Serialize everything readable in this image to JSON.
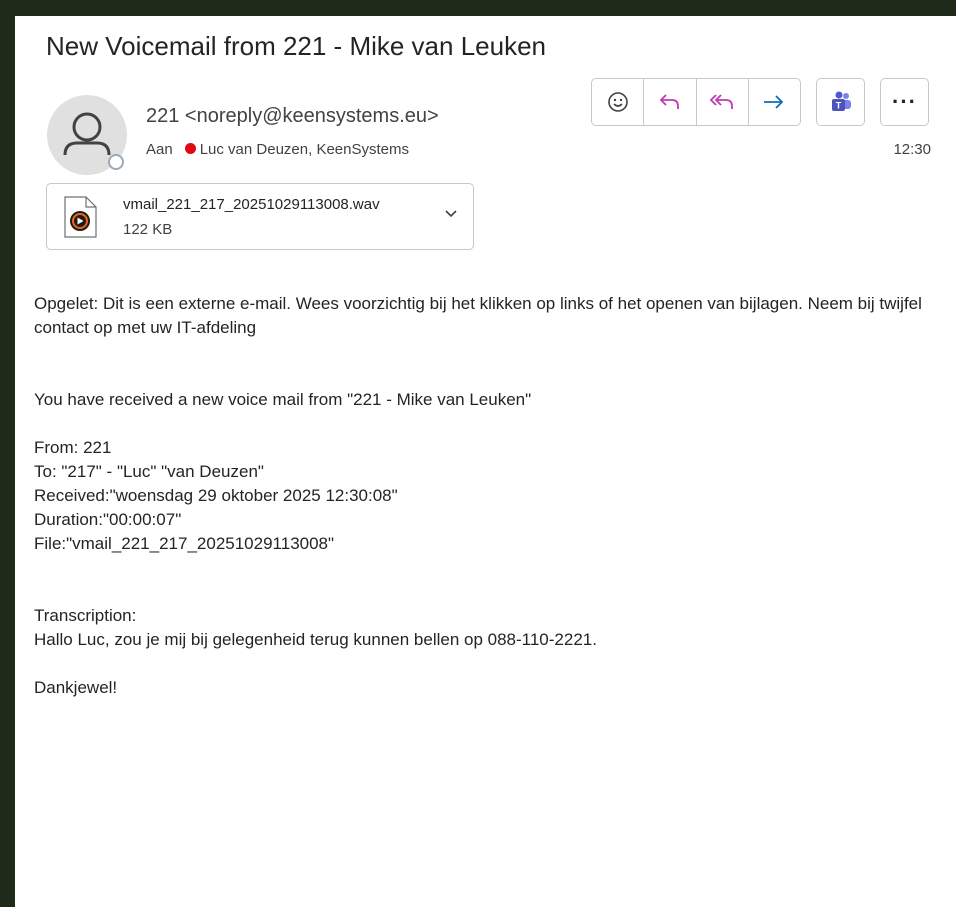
{
  "email": {
    "subject": "New Voicemail from 221 - Mike van Leuken",
    "sender": "221 <noreply@keensystems.eu>",
    "to_label": "Aan",
    "recipients": "Luc van Deuzen, KeenSystems",
    "time": "12:30"
  },
  "attachment": {
    "filename": "vmail_221_217_20251029113008.wav",
    "size": "122 KB"
  },
  "toolbar": {
    "icons": [
      "emoji-icon",
      "reply-icon",
      "reply-all-icon",
      "forward-icon",
      "teams-icon",
      "more-icon"
    ]
  },
  "body": {
    "warning": "Opgelet: Dit is een externe e-mail. Wees voorzichtig bij het klikken op links of het openen van bijlagen. Neem bij twijfel contact op met uw IT-afdeling",
    "intro": "You have received a new voice mail from \"221 - Mike van Leuken\"",
    "from": "From: 221",
    "to": "To: \"217\" - \"Luc\" \"van Deuzen\"",
    "received": "Received:\"woensdag 29 oktober 2025 12:30:08\"",
    "duration": "Duration:\"00:00:07\"",
    "file": "File:\"vmail_221_217_20251029113008\"",
    "transcription_label": "Transcription:",
    "transcription": "Hallo Luc, zou je mij bij gelegenheid terug kunnen bellen op 088-110-2221.",
    "closing": "Dankjewel!"
  },
  "colors": {
    "accent": "#c239b3",
    "forward": "#0f6cbd",
    "presence_busy": "#e30613",
    "teams": "#4b53bc"
  }
}
